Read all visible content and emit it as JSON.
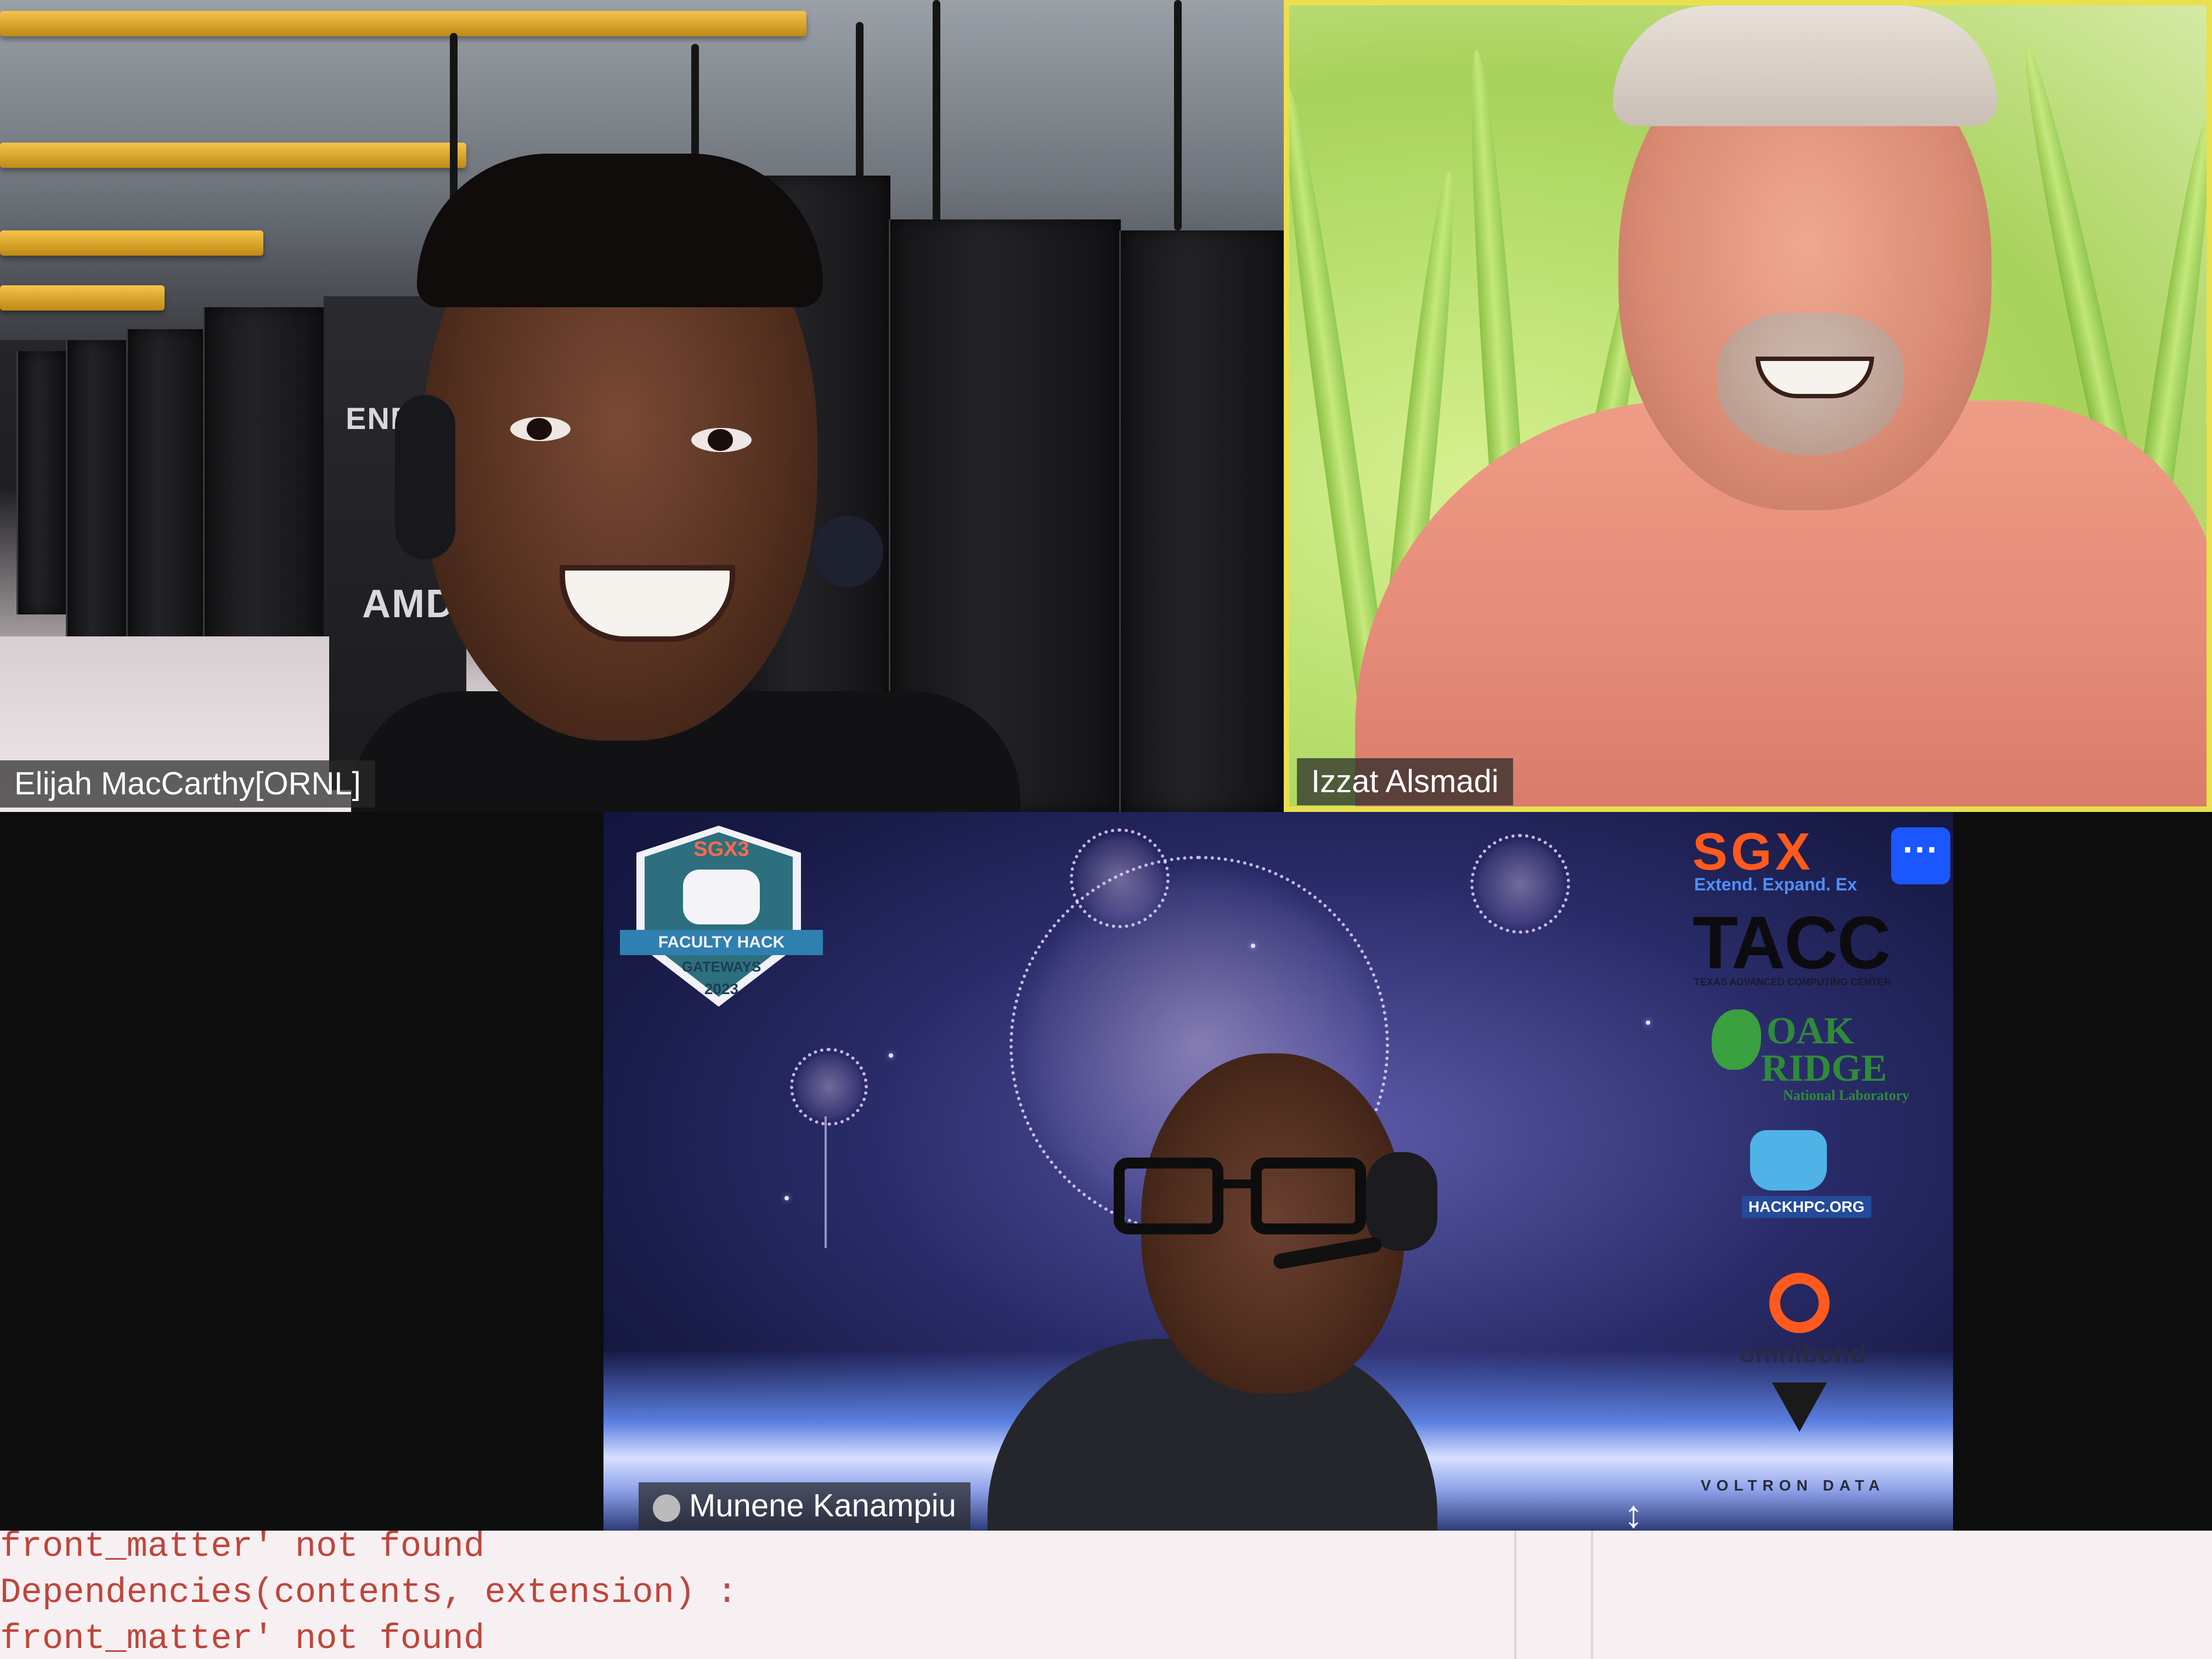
{
  "participants": [
    {
      "name": "Elijah MacCarthy[ORNL]"
    },
    {
      "name": "Izzat Alsmadi"
    },
    {
      "name": "Munene Kanampiu"
    }
  ],
  "background_logos": {
    "badge": {
      "top": "SGX3",
      "ribbon": "FACULTY HACK",
      "sub": "GATEWAYS",
      "year": "2023"
    },
    "sgx": "SGX",
    "sgx_tagline": "Extend. Expand. Ex",
    "tacc": "TACC",
    "tacc_sub": "TEXAS ADVANCED COMPUTING CENTER",
    "oak": "OAK",
    "ridge": "RIDGE",
    "ornl_sub": "National Laboratory",
    "hackhpc": "HACKHPC.ORG",
    "omnibond": "omnibond",
    "voltron": "VOLTRON DATA"
  },
  "rack_labels": {
    "energy": "ENER",
    "amd": "AMD"
  },
  "controls": {
    "more_label": "···",
    "resize_handle": "↕"
  },
  "terminal": {
    "lines": [
      "front_matter' not found",
      "Dependencies(contents, extension) :",
      "front_matter' not found"
    ]
  },
  "colors": {
    "active_speaker_border": "#e8e04e",
    "more_button": "#1a57ff",
    "terminal_text": "#c0453c"
  }
}
